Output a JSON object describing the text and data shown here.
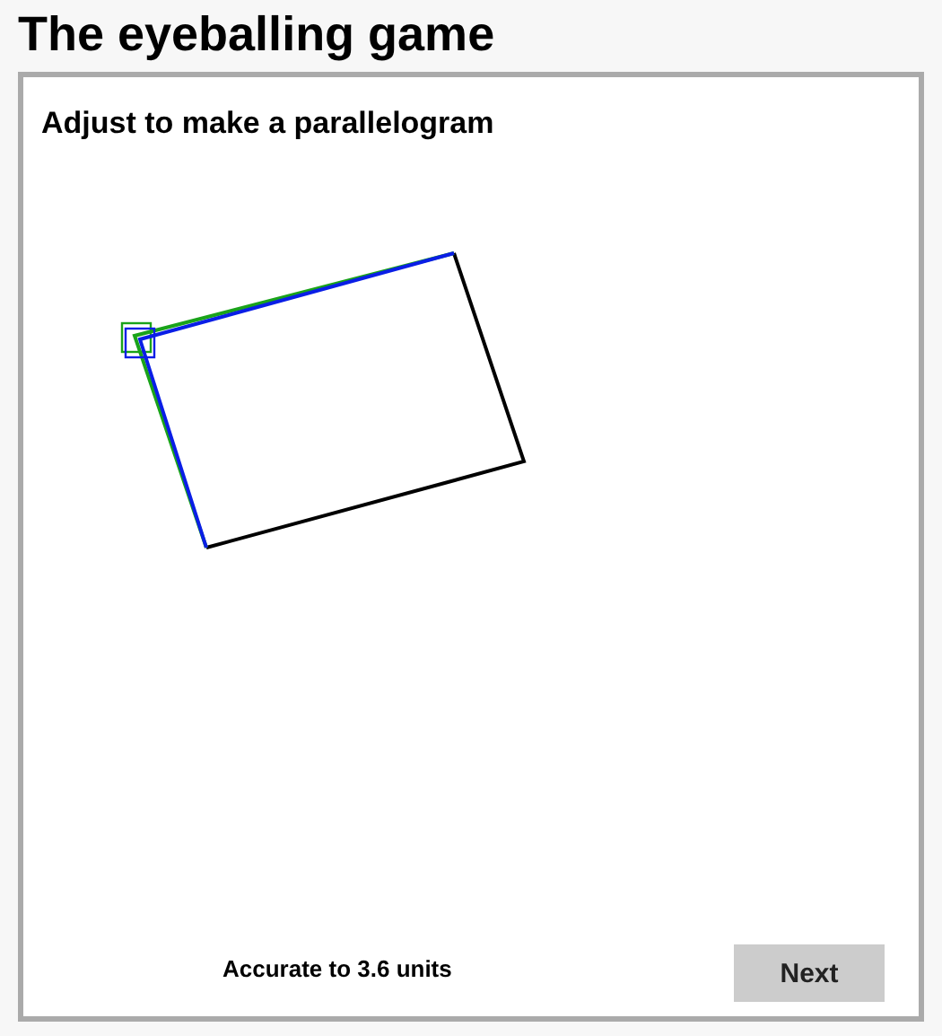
{
  "title": "The eyeballing game",
  "instruction": "Adjust to make a parallelogram",
  "result": "Accurate to 3.6 units",
  "button": "Next"
}
